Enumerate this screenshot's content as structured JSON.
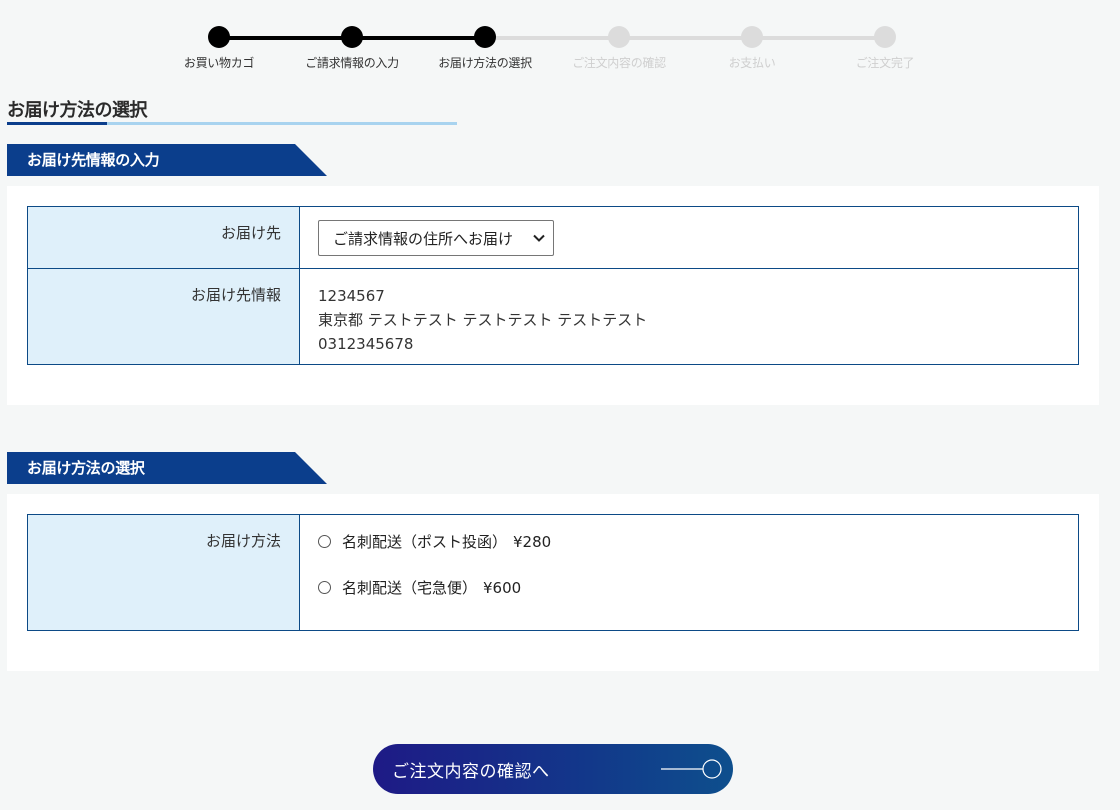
{
  "progress": {
    "steps": [
      {
        "label": "お買い物カゴ",
        "state": "done"
      },
      {
        "label": "ご請求情報の入力",
        "state": "done"
      },
      {
        "label": "お届け方法の選択",
        "state": "done"
      },
      {
        "label": "ご注文内容の確認",
        "state": "todo"
      },
      {
        "label": "お支払い",
        "state": "todo"
      },
      {
        "label": "ご注文完了",
        "state": "todo"
      }
    ],
    "current_step": 3,
    "total_steps": 6
  },
  "page": {
    "title": "お届け方法の選択"
  },
  "shipping_info": {
    "section_title": "お届け先情報の入力",
    "destination_label": "お届け先",
    "destination_select": {
      "selected": "ご請求情報の住所へお届け",
      "icon": "chevron-down-icon"
    },
    "details_label": "お届け先情報",
    "postal_code": "1234567",
    "address": "東京都 テストテスト テストテスト テストテスト",
    "phone": "0312345678"
  },
  "delivery": {
    "section_title": "お届け方法の選択",
    "method_label": "お届け方法",
    "options": [
      {
        "label": "名刺配送（ポスト投函）",
        "price": "¥280",
        "checked": false
      },
      {
        "label": "名刺配送（宅急便）",
        "price": "¥600",
        "checked": false
      }
    ]
  },
  "actions": {
    "confirm_label": "ご注文内容の確認へ",
    "confirm_icon": "arrow-right-circle-icon"
  },
  "colors": {
    "brand_navy": "#0b3e8c",
    "header_cell_bg": "#dff0fa",
    "border": "#0c4a86",
    "title_underline": "#a8d3ef",
    "step_done": "#000000",
    "step_todo": "#dcdcdc",
    "background": "#f5f7f7"
  }
}
